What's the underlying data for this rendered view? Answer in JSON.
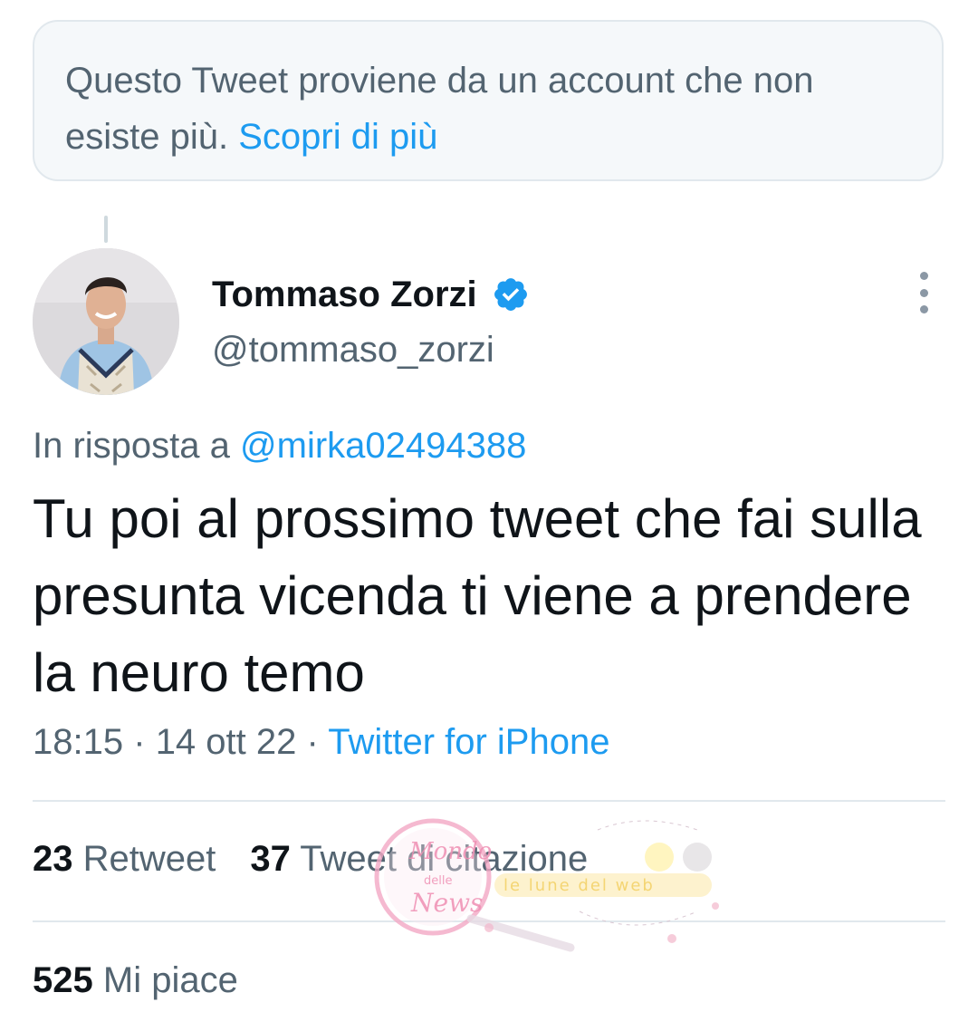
{
  "notice": {
    "text": "Questo Tweet proviene da un account che non esiste più.",
    "link": "Scopri di più"
  },
  "author": {
    "name": "Tommaso Zorzi",
    "handle": "@tommaso_zorzi",
    "verified": true
  },
  "reply": {
    "prefix": "In risposta a",
    "mention": "@mirka02494388"
  },
  "tweet": {
    "text": "Tu poi al prossimo tweet che fai sulla presunta vicenda ti viene a prendere la neuro temo"
  },
  "meta": {
    "time": "18:15",
    "date": "14 ott 22",
    "separator": "·",
    "source": "Twitter for iPhone"
  },
  "stats": {
    "retweets_count": "23",
    "retweets_label": "Retweet",
    "quotes_count": "37",
    "quotes_label": "Tweet di citazione",
    "likes_count": "525",
    "likes_label": "Mi piace"
  },
  "watermark": {
    "logo_text": "Mondo delle News",
    "tagline": "le lune del web"
  },
  "colors": {
    "accent": "#1d9bf0",
    "secondary_text": "#536471",
    "primary_text": "#0f1419",
    "border": "#e1e8ed",
    "notice_bg": "#f5f8fa"
  }
}
